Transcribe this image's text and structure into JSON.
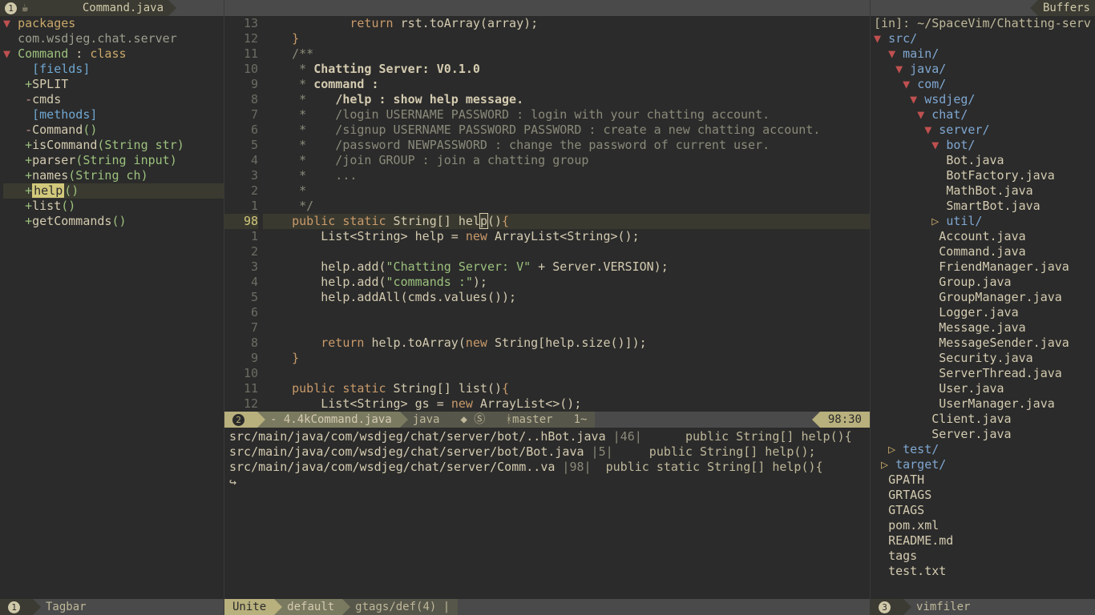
{
  "top": {
    "left_tab_badge": "1",
    "left_tab_icon": "☕",
    "left_tab": "Command.java",
    "right_tab": "Buffers"
  },
  "tagbar": {
    "packages_label": "packages",
    "package_name": "com.wsdjeg.chat.server",
    "class_label": "Command",
    "class_sep": " : ",
    "class_type": "class",
    "fields_label": "[fields]",
    "methods_label": "[methods]",
    "fields": [
      {
        "sym": "+",
        "name": "SPLIT"
      },
      {
        "sym": "-",
        "name": "cmds"
      }
    ],
    "methods": [
      {
        "sym": "-",
        "name": "Command",
        "sig": "()"
      },
      {
        "sym": "+",
        "name": "isCommand",
        "sig": "(String str)"
      },
      {
        "sym": "+",
        "name": "parser",
        "sig": "(String input)"
      },
      {
        "sym": "+",
        "name": "names",
        "sig": "(String ch)"
      },
      {
        "sym": "+",
        "name": "help",
        "sig": "()"
      },
      {
        "sym": "+",
        "name": "list",
        "sig": "()"
      },
      {
        "sym": "+",
        "name": "getCommands",
        "sig": "()"
      }
    ],
    "status_badge": "1",
    "status_label": "Tagbar"
  },
  "editor": {
    "rel_lines_before": [
      "13",
      "12",
      "11",
      "10",
      "9",
      "8",
      "7",
      "6",
      "5",
      "4",
      "3",
      "2",
      "1"
    ],
    "cur_line_no": "98",
    "rel_lines_after": [
      "1",
      "2",
      "3",
      "4",
      "5",
      "6",
      "7",
      "8",
      "9",
      "10",
      "11",
      "12"
    ],
    "lines_before": [
      "            return rst.toArray(array);",
      "    }",
      "    /**",
      "     * Chatting Server: V0.1.0",
      "     * command :",
      "     *    /help : show help message.",
      "     *    /login USERNAME PASSWORD : login with your chatting account.",
      "     *    /signup USERNAME PASSWORD PASSWORD : create a new chatting account.",
      "     *    /password NEWPASSWORD : change the password of current user.",
      "     *    /join GROUP : join a chatting group",
      "     *    ...",
      "     *",
      "     */"
    ],
    "lines_after": [
      "        List<String> help = new ArrayList<String>();",
      "",
      "        help.add(\"Chatting Server: V\" + Server.VERSION);",
      "        help.add(\"commands :\");",
      "        help.addAll(cmds.values());",
      "",
      "",
      "        return help.toArray(new String[help.size()]);",
      "    }",
      "",
      "    public static String[] list(){",
      "        List<String> gs = new ArrayList<>();"
    ]
  },
  "airline": {
    "badge": "2",
    "size": "- 4.4k",
    "file": "Command.java",
    "type": "java",
    "icons": "◆ Ⓢ   ",
    "branch_icon": "ᚼ",
    "branch": "master",
    "ff": "1~",
    "pos": "98:30"
  },
  "unite_results": [
    {
      "path": "src/main/java/com/wsdjeg/chat/server/bot/..hBot.java",
      "ln": "|46|",
      "sig": "      public String[] help(){"
    },
    {
      "path": "src/main/java/com/wsdjeg/chat/server/bot/Bot.java",
      "ln": " |5|",
      "sig": "     public String[] help();"
    },
    {
      "path": "src/main/java/com/wsdjeg/chat/server/Comm..va",
      "ln": " |98|",
      "sig": "  public static String[] help(){"
    }
  ],
  "unite_caret": "↪",
  "unite_status": {
    "a": "Unite",
    "b": "default",
    "c": "gtags/def(4) |"
  },
  "filetree": {
    "header": "[in]: ~/SpaceVim/Chatting-serv",
    "root": "src/",
    "main": "main/",
    "java": "java/",
    "com": "com/",
    "wsdjeg": "wsdjeg/",
    "chat": "chat/",
    "server": "server/",
    "bot": "bot/",
    "bots": [
      "Bot.java",
      "BotFactory.java",
      "MathBot.java",
      "SmartBot.java"
    ],
    "util": "util/",
    "server_files": [
      "Account.java",
      "Command.java",
      "FriendManager.java",
      "Group.java",
      "GroupManager.java",
      "Logger.java",
      "Message.java",
      "MessageSender.java",
      "Security.java",
      "ServerThread.java",
      "User.java",
      "UserManager.java"
    ],
    "chat_files": [
      "Client.java",
      "Server.java"
    ],
    "test": "test/",
    "target": "target/",
    "root_files": [
      "GPATH",
      "GRTAGS",
      "GTAGS",
      "pom.xml",
      "README.md",
      "tags",
      "test.txt"
    ],
    "status_badge": "3",
    "status_label": "vimfiler"
  }
}
